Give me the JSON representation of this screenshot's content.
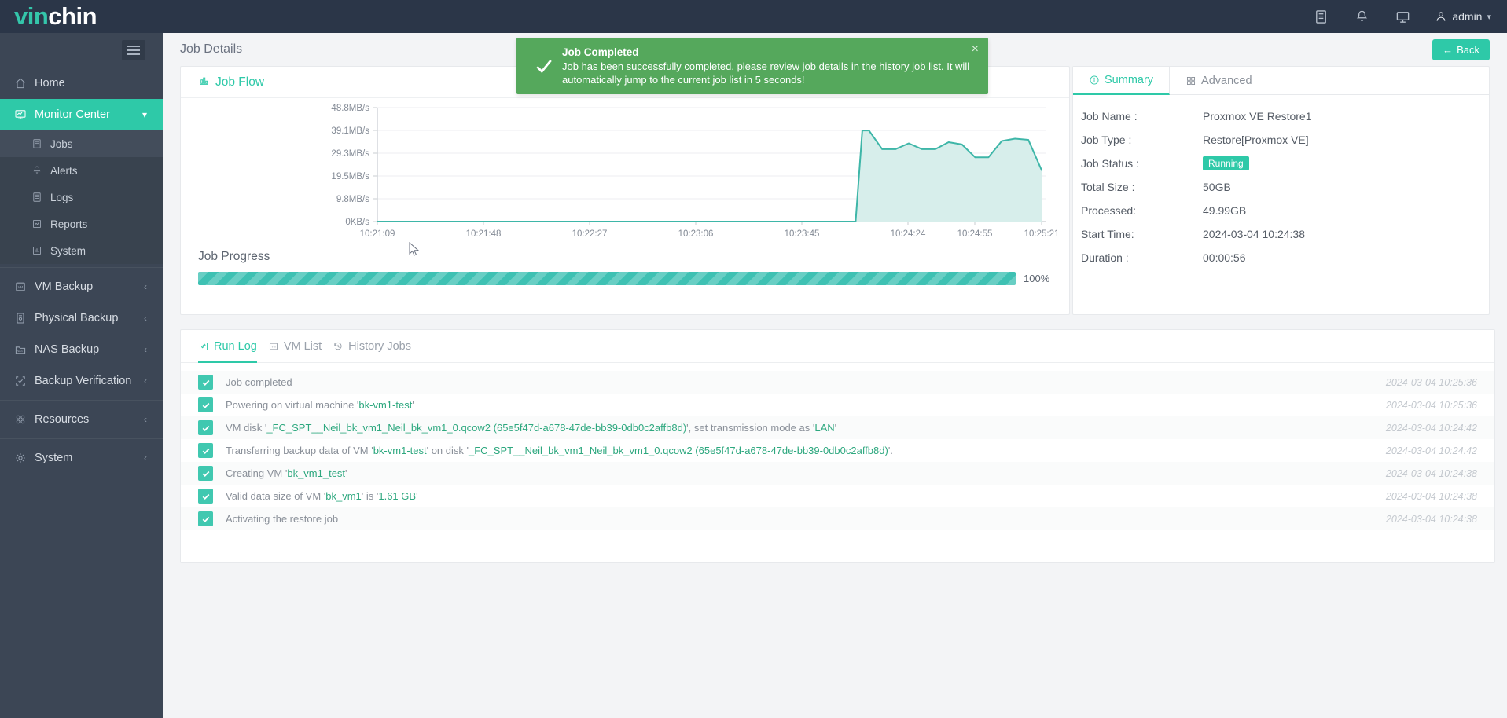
{
  "brand": {
    "part1": "vin",
    "part2": "chin"
  },
  "topbar": {
    "icons": [
      {
        "name": "list-icon"
      },
      {
        "name": "bell-icon"
      },
      {
        "name": "monitor-icon"
      }
    ],
    "user": "admin"
  },
  "sidebar": {
    "items": [
      {
        "label": "Home",
        "icon": "home-icon",
        "active": false,
        "expandable": false
      },
      {
        "label": "Monitor Center",
        "icon": "monitor-center-icon",
        "active": true,
        "expandable": true
      },
      {
        "label": "VM Backup",
        "icon": "vm-icon",
        "active": false,
        "expandable": true
      },
      {
        "label": "Physical Backup",
        "icon": "server-icon",
        "active": false,
        "expandable": true
      },
      {
        "label": "NAS Backup",
        "icon": "nas-icon",
        "active": false,
        "expandable": true
      },
      {
        "label": "Backup Verification",
        "icon": "verify-icon",
        "active": false,
        "expandable": true
      },
      {
        "label": "Resources",
        "icon": "resources-icon",
        "active": false,
        "expandable": true
      },
      {
        "label": "System",
        "icon": "gear-icon",
        "active": false,
        "expandable": true
      }
    ],
    "subitems": [
      {
        "label": "Jobs",
        "icon": "jobs-icon",
        "current": true
      },
      {
        "label": "Alerts",
        "icon": "alert-bell-icon",
        "current": false
      },
      {
        "label": "Logs",
        "icon": "logs-icon",
        "current": false
      },
      {
        "label": "Reports",
        "icon": "reports-icon",
        "current": false
      },
      {
        "label": "System",
        "icon": "system-chart-icon",
        "current": false
      }
    ]
  },
  "page": {
    "title": "Job Details",
    "back_label": "Back"
  },
  "toast": {
    "title": "Job Completed",
    "message": "Job has been successfully completed, please review job details in the history job list. It will automatically jump to the current job list in 5 seconds!",
    "close": "×",
    "color": "#55a85c"
  },
  "job_flow": {
    "title": "Job Flow"
  },
  "progress": {
    "label": "Job Progress",
    "percent_text": "100%",
    "percent": 100,
    "color": "#3ec1b3"
  },
  "summary": {
    "tabs": [
      {
        "label": "Summary",
        "icon": "info-icon",
        "active": true
      },
      {
        "label": "Advanced",
        "icon": "grid-icon",
        "active": false
      }
    ],
    "rows": [
      {
        "key": "Job Name :",
        "value": "Proxmox VE Restore1",
        "badge": false
      },
      {
        "key": "Job Type :",
        "value": "Restore[Proxmox VE]",
        "badge": false
      },
      {
        "key": "Job Status :",
        "value": "Running",
        "badge": true
      },
      {
        "key": "Total Size :",
        "value": "50GB",
        "badge": false
      },
      {
        "key": "Processed:",
        "value": "49.99GB",
        "badge": false
      },
      {
        "key": "Start Time:",
        "value": "2024-03-04 10:24:38",
        "badge": false
      },
      {
        "key": "Duration :",
        "value": "00:00:56",
        "badge": false
      }
    ],
    "badge_color": "#2ec9a8"
  },
  "log_tabs": [
    {
      "label": "Run Log",
      "icon": "runlog-icon",
      "active": true
    },
    {
      "label": "VM List",
      "icon": "vmlist-icon",
      "active": false
    },
    {
      "label": "History Jobs",
      "icon": "history-icon",
      "active": false
    }
  ],
  "log_rows": [
    {
      "parts": [
        {
          "t": "Job completed",
          "hl": false
        }
      ],
      "time": "2024-03-04 10:25:36"
    },
    {
      "parts": [
        {
          "t": "Powering on virtual machine '",
          "hl": false
        },
        {
          "t": "bk-vm1-test",
          "hl": true
        },
        {
          "t": "'",
          "hl": false
        }
      ],
      "time": "2024-03-04 10:25:36"
    },
    {
      "parts": [
        {
          "t": "VM disk '",
          "hl": false
        },
        {
          "t": "_FC_SPT__Neil_bk_vm1_Neil_bk_vm1_0.qcow2 (65e5f47d-a678-47de-bb39-0db0c2affb8d)",
          "hl": true
        },
        {
          "t": "', set transmission mode as '",
          "hl": false
        },
        {
          "t": "LAN",
          "hl": true
        },
        {
          "t": "'",
          "hl": false
        }
      ],
      "time": "2024-03-04 10:24:42"
    },
    {
      "parts": [
        {
          "t": "Transferring backup data of VM '",
          "hl": false
        },
        {
          "t": "bk-vm1-test",
          "hl": true
        },
        {
          "t": "' on disk '",
          "hl": false
        },
        {
          "t": "_FC_SPT__Neil_bk_vm1_Neil_bk_vm1_0.qcow2 (65e5f47d-a678-47de-bb39-0db0c2affb8d)",
          "hl": true
        },
        {
          "t": "'.",
          "hl": false
        }
      ],
      "time": "2024-03-04 10:24:42"
    },
    {
      "parts": [
        {
          "t": "Creating VM '",
          "hl": false
        },
        {
          "t": "bk_vm1_test",
          "hl": true
        },
        {
          "t": "'",
          "hl": false
        }
      ],
      "time": "2024-03-04 10:24:38"
    },
    {
      "parts": [
        {
          "t": "Valid data size of VM '",
          "hl": false
        },
        {
          "t": "bk_vm1",
          "hl": true
        },
        {
          "t": "' is '",
          "hl": false
        },
        {
          "t": "1.61 GB",
          "hl": true
        },
        {
          "t": "'",
          "hl": false
        }
      ],
      "time": "2024-03-04 10:24:38"
    },
    {
      "parts": [
        {
          "t": "Activating the restore job",
          "hl": false
        }
      ],
      "time": "2024-03-04 10:24:38"
    }
  ],
  "chart_data": {
    "type": "area",
    "title": "Job Flow",
    "xlabel": "",
    "ylabel": "",
    "line_color": "#3eb6a8",
    "fill_color": "#d7eeeb",
    "ytick_labels": [
      "48.8MB/s",
      "39.1MB/s",
      "29.3MB/s",
      "19.5MB/s",
      "9.8MB/s",
      "0KB/s"
    ],
    "ytick_values": [
      48.8,
      39.1,
      29.3,
      19.5,
      9.8,
      0
    ],
    "ylim": [
      0,
      48.8
    ],
    "xtick_labels": [
      "10:21:09",
      "10:21:48",
      "10:22:27",
      "10:23:06",
      "10:23:45",
      "10:24:24",
      "10:24:55",
      "10:25:21"
    ],
    "grid": true,
    "legend": "none",
    "x": [
      0,
      5,
      10,
      15,
      20,
      25,
      30,
      35,
      40,
      45,
      50,
      55,
      60,
      65,
      70,
      72,
      73,
      74,
      76,
      78,
      80,
      82,
      84,
      86,
      88,
      90,
      92,
      94,
      96,
      98,
      100
    ],
    "values": [
      0,
      0,
      0,
      0,
      0,
      0,
      0,
      0,
      0,
      0,
      0,
      0,
      0,
      0,
      0,
      0,
      39.0,
      39.0,
      31.0,
      31.0,
      33.5,
      31.0,
      31.0,
      34.0,
      33.0,
      27.5,
      27.5,
      34.5,
      35.5,
      35.0,
      22.0
    ]
  }
}
